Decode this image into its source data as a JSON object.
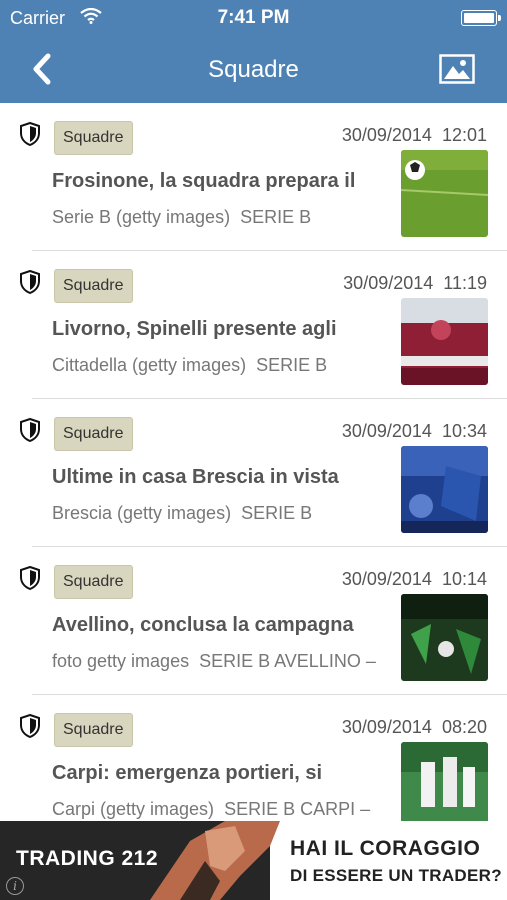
{
  "status_bar": {
    "carrier": "Carrier",
    "time": "7:41 PM"
  },
  "nav": {
    "title": "Squadre",
    "back_icon": "chevron-left-icon",
    "gallery_icon": "image-gallery-icon"
  },
  "colors": {
    "header": "#4f82b4",
    "tag_bg": "#d9d6bf"
  },
  "articles": [
    {
      "tag": "Squadre",
      "date": "30/09/2014",
      "time": "12:01",
      "headline": "Frosinone, la squadra prepara il",
      "source": "Serie B (getty images)",
      "category": "SERIE B"
    },
    {
      "tag": "Squadre",
      "date": "30/09/2014",
      "time": "11:19",
      "headline": "Livorno, Spinelli presente agli",
      "source": "Cittadella (getty images)",
      "category": "SERIE B"
    },
    {
      "tag": "Squadre",
      "date": "30/09/2014",
      "time": "10:34",
      "headline": "Ultime in casa Brescia in vista",
      "source": "Brescia (getty images)",
      "category": "SERIE B"
    },
    {
      "tag": "Squadre",
      "date": "30/09/2014",
      "time": "10:14",
      "headline": "Avellino, conclusa la campagna",
      "source": "foto getty images",
      "category": "SERIE B AVELLINO –"
    },
    {
      "tag": "Squadre",
      "date": "30/09/2014",
      "time": "08:20",
      "headline": "Carpi: emergenza portieri, si",
      "source": "Carpi (getty images)",
      "category": "SERIE B CARPI –"
    }
  ],
  "ad": {
    "brand": "TRADING 212",
    "line1": "HAI IL CORAGGIO",
    "line2": "DI ESSERE UN TRADER?",
    "info": "i"
  }
}
